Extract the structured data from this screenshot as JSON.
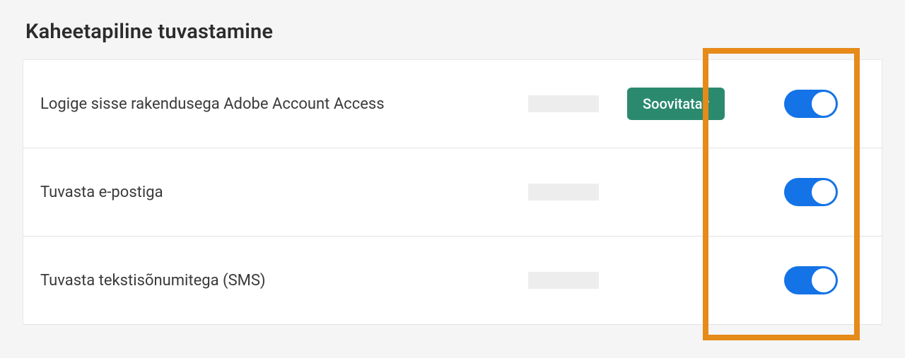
{
  "section": {
    "title": "Kaheetapiline tuvastamine",
    "rows": [
      {
        "label": "Logige sisse rakendusega Adobe Account Access",
        "hasBadge": true,
        "badgeLabel": "Soovitatav",
        "toggleOn": true
      },
      {
        "label": "Tuvasta e-postiga",
        "hasBadge": false,
        "toggleOn": true
      },
      {
        "label": "Tuvasta tekstisõnumitega (SMS)",
        "hasBadge": false,
        "toggleOn": true
      }
    ]
  },
  "colors": {
    "accent": "#1473e6",
    "badge": "#2b8a6e",
    "highlight": "#e68a19"
  }
}
